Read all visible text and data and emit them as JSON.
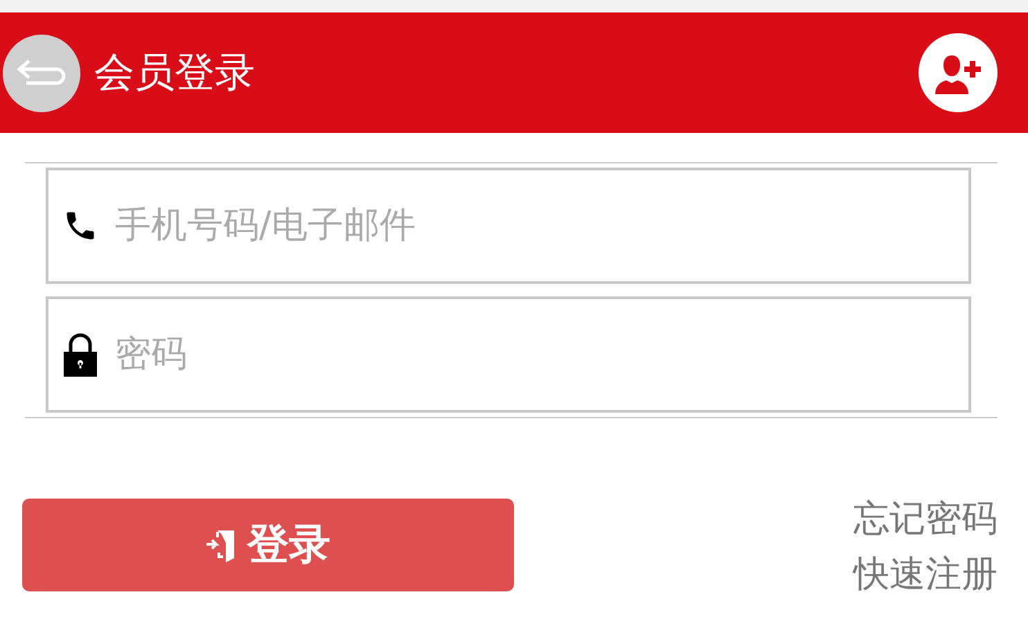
{
  "header": {
    "title": "会员登录"
  },
  "fields": [
    {
      "kind": "phone",
      "placeholder": "手机号码/电子邮件"
    },
    {
      "kind": "password",
      "placeholder": "密码"
    }
  ],
  "login_button": "登录",
  "links": [
    "忘记密码",
    "快速注册"
  ]
}
